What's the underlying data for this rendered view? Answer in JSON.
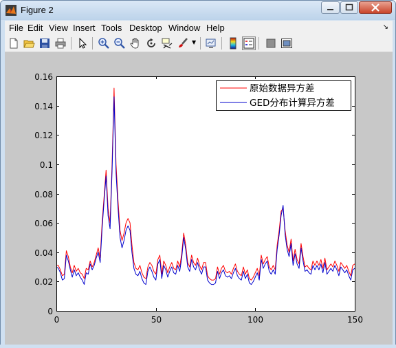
{
  "window": {
    "title": "Figure 2"
  },
  "menu": {
    "items": [
      "File",
      "Edit",
      "View",
      "Insert",
      "Tools",
      "Desktop",
      "Window",
      "Help"
    ]
  },
  "toolbar": {
    "buttons": [
      "new-figure-icon",
      "open-file-icon",
      "save-icon",
      "print-icon",
      "pointer-icon",
      "zoom-in-icon",
      "zoom-out-icon",
      "pan-hand-icon",
      "rotate-3d-icon",
      "data-cursor-icon",
      "brush-icon",
      "link-plot-icon",
      "colorbar-icon",
      "legend-icon",
      "hide-plot-tools-icon",
      "show-plot-tools-icon"
    ]
  },
  "colors": {
    "series1": "#ff0000",
    "series2": "#0000cc",
    "axes_bg": "#ffffff",
    "figure_bg": "#c8c8c8"
  },
  "chart_data": {
    "type": "line",
    "title": "",
    "xlabel": "",
    "ylabel": "",
    "xlim": [
      0,
      150
    ],
    "ylim": [
      0,
      0.16
    ],
    "xticks": [
      0,
      50,
      100,
      150
    ],
    "yticks": [
      0,
      0.02,
      0.04,
      0.06,
      0.08,
      0.1,
      0.12,
      0.14,
      0.16
    ],
    "xtick_labels": [
      "0",
      "50",
      "100",
      "150"
    ],
    "ytick_labels": [
      "0",
      "0.02",
      "0.04",
      "0.06",
      "0.08",
      "0.1",
      "0.12",
      "0.14",
      "0.16"
    ],
    "grid": false,
    "legend_position": "top-right",
    "series": [
      {
        "name": "原始数据异方差",
        "color": "#ff0000",
        "x": [
          0,
          1,
          2,
          3,
          4,
          5,
          6,
          7,
          8,
          9,
          10,
          11,
          12,
          13,
          14,
          15,
          16,
          17,
          18,
          19,
          20,
          21,
          22,
          23,
          24,
          25,
          26,
          27,
          28,
          29,
          30,
          31,
          32,
          33,
          34,
          35,
          36,
          37,
          38,
          39,
          40,
          41,
          42,
          43,
          44,
          45,
          46,
          47,
          48,
          49,
          50,
          51,
          52,
          53,
          54,
          55,
          56,
          57,
          58,
          59,
          60,
          61,
          62,
          63,
          64,
          65,
          66,
          67,
          68,
          69,
          70,
          71,
          72,
          73,
          74,
          75,
          76,
          77,
          78,
          79,
          80,
          81,
          82,
          83,
          84,
          85,
          86,
          87,
          88,
          89,
          90,
          91,
          92,
          93,
          94,
          95,
          96,
          97,
          98,
          99,
          100,
          101,
          102,
          103,
          104,
          105,
          106,
          107,
          108,
          109,
          110,
          111,
          112,
          113,
          114,
          115,
          116,
          117,
          118,
          119,
          120,
          121,
          122,
          123,
          124,
          125,
          126,
          127,
          128,
          129,
          130,
          131,
          132,
          133,
          134,
          135,
          136,
          137,
          138,
          139,
          140,
          141,
          142,
          143,
          144,
          145,
          146,
          147,
          148,
          149,
          150
        ],
        "y": [
          0.031,
          0.031,
          0.028,
          0.024,
          0.025,
          0.041,
          0.037,
          0.03,
          0.026,
          0.031,
          0.027,
          0.029,
          0.026,
          0.025,
          0.022,
          0.029,
          0.028,
          0.034,
          0.03,
          0.033,
          0.038,
          0.043,
          0.036,
          0.06,
          0.078,
          0.096,
          0.07,
          0.06,
          0.1,
          0.152,
          0.1,
          0.075,
          0.055,
          0.048,
          0.053,
          0.06,
          0.063,
          0.06,
          0.045,
          0.033,
          0.029,
          0.028,
          0.031,
          0.026,
          0.023,
          0.022,
          0.03,
          0.033,
          0.031,
          0.027,
          0.025,
          0.035,
          0.038,
          0.025,
          0.034,
          0.031,
          0.026,
          0.03,
          0.033,
          0.029,
          0.028,
          0.034,
          0.03,
          0.039,
          0.053,
          0.045,
          0.033,
          0.03,
          0.038,
          0.033,
          0.031,
          0.036,
          0.031,
          0.028,
          0.033,
          0.033,
          0.024,
          0.022,
          0.021,
          0.021,
          0.022,
          0.03,
          0.025,
          0.029,
          0.031,
          0.027,
          0.026,
          0.027,
          0.025,
          0.029,
          0.032,
          0.027,
          0.025,
          0.024,
          0.03,
          0.025,
          0.028,
          0.022,
          0.021,
          0.023,
          0.026,
          0.029,
          0.024,
          0.038,
          0.032,
          0.035,
          0.037,
          0.03,
          0.028,
          0.031,
          0.028,
          0.045,
          0.055,
          0.068,
          0.07,
          0.055,
          0.045,
          0.04,
          0.049,
          0.034,
          0.042,
          0.035,
          0.032,
          0.046,
          0.037,
          0.03,
          0.031,
          0.029,
          0.028,
          0.034,
          0.031,
          0.034,
          0.031,
          0.035,
          0.029,
          0.036,
          0.028,
          0.03,
          0.032,
          0.03,
          0.034,
          0.031,
          0.027,
          0.033,
          0.031,
          0.029,
          0.031,
          0.027,
          0.024,
          0.031,
          0.032
        ]
      },
      {
        "name": "GED分布计算异方差",
        "color": "#0000cc",
        "x": [
          0,
          1,
          2,
          3,
          4,
          5,
          6,
          7,
          8,
          9,
          10,
          11,
          12,
          13,
          14,
          15,
          16,
          17,
          18,
          19,
          20,
          21,
          22,
          23,
          24,
          25,
          26,
          27,
          28,
          29,
          30,
          31,
          32,
          33,
          34,
          35,
          36,
          37,
          38,
          39,
          40,
          41,
          42,
          43,
          44,
          45,
          46,
          47,
          48,
          49,
          50,
          51,
          52,
          53,
          54,
          55,
          56,
          57,
          58,
          59,
          60,
          61,
          62,
          63,
          64,
          65,
          66,
          67,
          68,
          69,
          70,
          71,
          72,
          73,
          74,
          75,
          76,
          77,
          78,
          79,
          80,
          81,
          82,
          83,
          84,
          85,
          86,
          87,
          88,
          89,
          90,
          91,
          92,
          93,
          94,
          95,
          96,
          97,
          98,
          99,
          100,
          101,
          102,
          103,
          104,
          105,
          106,
          107,
          108,
          109,
          110,
          111,
          112,
          113,
          114,
          115,
          116,
          117,
          118,
          119,
          120,
          121,
          122,
          123,
          124,
          125,
          126,
          127,
          128,
          129,
          130,
          131,
          132,
          133,
          134,
          135,
          136,
          137,
          138,
          139,
          140,
          141,
          142,
          143,
          144,
          145,
          146,
          147,
          148,
          149,
          150
        ],
        "y": [
          0.03,
          0.029,
          0.026,
          0.021,
          0.022,
          0.038,
          0.034,
          0.028,
          0.023,
          0.028,
          0.024,
          0.026,
          0.023,
          0.021,
          0.018,
          0.026,
          0.025,
          0.032,
          0.028,
          0.031,
          0.036,
          0.04,
          0.033,
          0.056,
          0.075,
          0.092,
          0.065,
          0.056,
          0.095,
          0.146,
          0.094,
          0.07,
          0.05,
          0.043,
          0.048,
          0.055,
          0.058,
          0.055,
          0.04,
          0.029,
          0.025,
          0.024,
          0.027,
          0.022,
          0.019,
          0.018,
          0.027,
          0.03,
          0.027,
          0.023,
          0.021,
          0.032,
          0.035,
          0.022,
          0.031,
          0.028,
          0.023,
          0.027,
          0.03,
          0.026,
          0.025,
          0.031,
          0.027,
          0.036,
          0.05,
          0.042,
          0.03,
          0.027,
          0.035,
          0.03,
          0.028,
          0.033,
          0.028,
          0.025,
          0.03,
          0.03,
          0.021,
          0.019,
          0.018,
          0.018,
          0.019,
          0.027,
          0.022,
          0.026,
          0.028,
          0.024,
          0.023,
          0.024,
          0.022,
          0.026,
          0.029,
          0.024,
          0.022,
          0.021,
          0.027,
          0.022,
          0.025,
          0.019,
          0.018,
          0.02,
          0.023,
          0.026,
          0.021,
          0.035,
          0.029,
          0.032,
          0.034,
          0.027,
          0.025,
          0.028,
          0.025,
          0.042,
          0.052,
          0.065,
          0.072,
          0.052,
          0.042,
          0.037,
          0.046,
          0.031,
          0.039,
          0.032,
          0.029,
          0.043,
          0.034,
          0.027,
          0.028,
          0.026,
          0.025,
          0.031,
          0.028,
          0.031,
          0.028,
          0.032,
          0.026,
          0.033,
          0.025,
          0.027,
          0.029,
          0.027,
          0.031,
          0.028,
          0.024,
          0.03,
          0.028,
          0.026,
          0.028,
          0.024,
          0.021,
          0.028,
          0.029
        ]
      }
    ]
  }
}
